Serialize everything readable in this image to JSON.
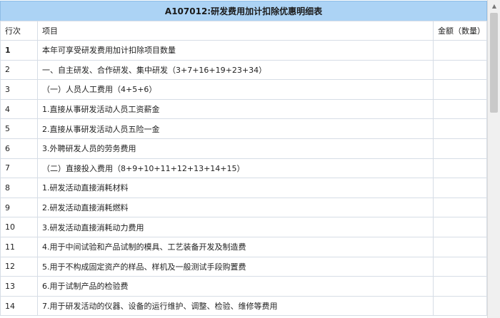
{
  "title": "A107012:研发费用加计扣除优惠明细表",
  "columns": {
    "row_no": "行次",
    "item": "项目",
    "amount": "金额（数量）"
  },
  "rows": [
    {
      "no": "1",
      "item": "本年可享受研发费用加计扣除项目数量",
      "amount": ""
    },
    {
      "no": "2",
      "item": "一、自主研发、合作研发、集中研发（3+7+16+19+23+34）",
      "amount": ""
    },
    {
      "no": "3",
      "item": "（一）人员人工费用（4+5+6）",
      "amount": ""
    },
    {
      "no": "4",
      "item": "1.直接从事研发活动人员工资薪金",
      "amount": ""
    },
    {
      "no": "5",
      "item": "2.直接从事研发活动人员五险一金",
      "amount": ""
    },
    {
      "no": "6",
      "item": "3.外聘研发人员的劳务费用",
      "amount": ""
    },
    {
      "no": "7",
      "item": "（二）直接投入费用（8+9+10+11+12+13+14+15）",
      "amount": ""
    },
    {
      "no": "8",
      "item": "1.研发活动直接消耗材料",
      "amount": ""
    },
    {
      "no": "9",
      "item": "2.研发活动直接消耗燃料",
      "amount": ""
    },
    {
      "no": "10",
      "item": "3.研发活动直接消耗动力费用",
      "amount": ""
    },
    {
      "no": "11",
      "item": "4.用于中间试验和产品试制的模具、工艺装备开发及制造费",
      "amount": ""
    },
    {
      "no": "12",
      "item": "5.用于不构成固定资产的样品、样机及一般测试手段购置费",
      "amount": ""
    },
    {
      "no": "13",
      "item": "6.用于试制产品的检验费",
      "amount": ""
    },
    {
      "no": "14",
      "item": "7.用于研发活动的仪器、设备的运行维护、调整、检验、维修等费用",
      "amount": ""
    }
  ],
  "colors": {
    "title_background": "#acd3f5",
    "grid_border": "#d6dde6"
  }
}
